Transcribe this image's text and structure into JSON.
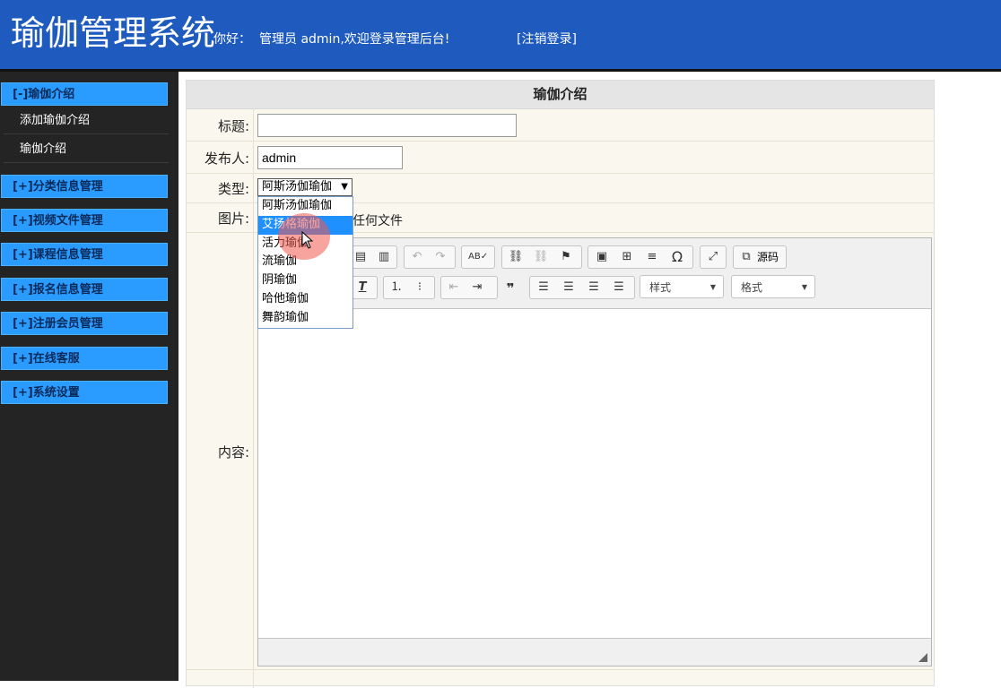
{
  "header": {
    "title": "瑜伽管理系统",
    "greeting": "你好：",
    "user_text": "管理员 admin,欢迎登录管理后台!",
    "logout": "[注销登录]"
  },
  "sidebar": {
    "menus": [
      {
        "label": "[-]瑜伽介绍",
        "expanded": true,
        "items": [
          "添加瑜伽介绍",
          "瑜伽介绍"
        ]
      },
      {
        "label": "[+]分类信息管理"
      },
      {
        "label": "[+]视频文件管理"
      },
      {
        "label": "[+]课程信息管理"
      },
      {
        "label": "[+]报名信息管理"
      },
      {
        "label": "[+]注册会员管理"
      },
      {
        "label": "[+]在线客服"
      },
      {
        "label": "[+]系统设置"
      }
    ]
  },
  "form": {
    "title": "瑜伽介绍",
    "fields": {
      "title_label": "标题:",
      "title_value": "",
      "publisher_label": "发布人:",
      "publisher_value": "admin",
      "type_label": "类型:",
      "type_value": "阿斯汤伽瑜伽",
      "image_label": "图片:",
      "image_status": "择任何文件",
      "content_label": "内容:"
    },
    "type_options": [
      "阿斯汤伽瑜伽",
      "艾扬格瑜伽",
      "活力瑜伽",
      "流瑜伽",
      "阴瑜伽",
      "哈他瑜伽",
      "舞韵瑜伽"
    ],
    "type_highlighted": "艾扬格瑜伽"
  },
  "editor": {
    "source_label": "源码",
    "style_combo": "样式",
    "format_combo": "格式"
  }
}
